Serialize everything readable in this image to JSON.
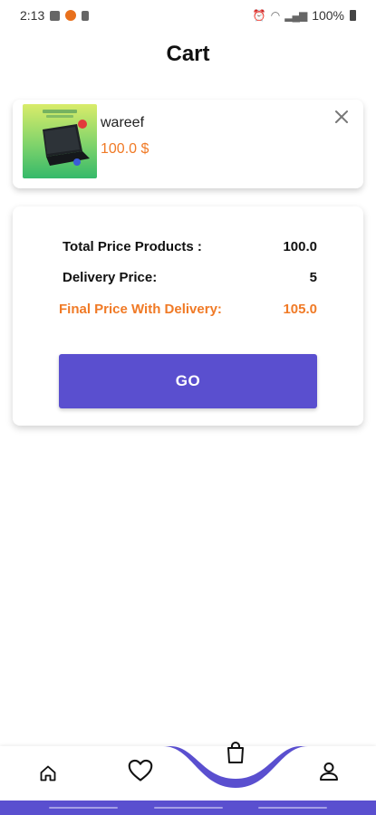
{
  "status_bar": {
    "time": "2:13",
    "battery": "100%"
  },
  "page": {
    "title": "Cart"
  },
  "cart_items": [
    {
      "name": "wareef",
      "price": "100.0 $",
      "image_icon": "laptop-product-image"
    }
  ],
  "summary": {
    "total_label": "Total Price Products :",
    "total_value": "100.0",
    "delivery_label": "Delivery Price:",
    "delivery_value": "5",
    "final_label": "Final Price With Delivery:",
    "final_value": "105.0",
    "go_label": "GO"
  },
  "bottom_nav": {
    "items": [
      "home-icon",
      "heart-icon",
      "shopping-bag-icon",
      "user-icon"
    ],
    "active": "shopping-bag-icon"
  },
  "colors": {
    "accent": "#5a4fcf",
    "price": "#f07a26"
  }
}
